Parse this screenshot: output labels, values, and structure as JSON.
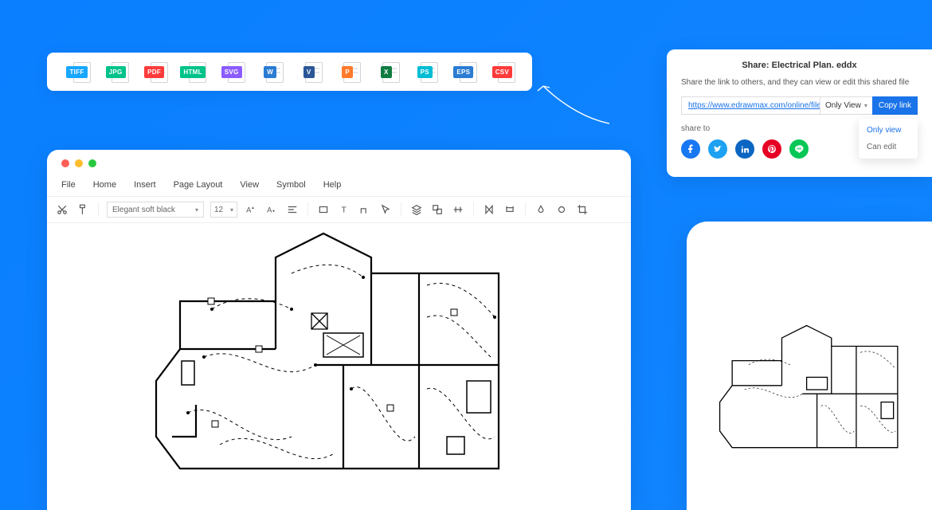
{
  "export_formats": [
    {
      "label": "TIFF",
      "color": "#18a7ff"
    },
    {
      "label": "JPG",
      "color": "#00c389"
    },
    {
      "label": "PDF",
      "color": "#ff3b3b"
    },
    {
      "label": "HTML",
      "color": "#00c389"
    },
    {
      "label": "SVG",
      "color": "#8b5cff"
    },
    {
      "label": "W",
      "color": "#2b7cd3"
    },
    {
      "label": "V",
      "color": "#2b5797"
    },
    {
      "label": "P",
      "color": "#ff7a2b"
    },
    {
      "label": "X",
      "color": "#107c41"
    },
    {
      "label": "PS",
      "color": "#00bcd4"
    },
    {
      "label": "EPS",
      "color": "#2b7cd3"
    },
    {
      "label": "CSV",
      "color": "#ff3b3b"
    }
  ],
  "editor": {
    "menus": [
      "File",
      "Home",
      "Insert",
      "Page Layout",
      "View",
      "Symbol",
      "Help"
    ],
    "font_name": "Elegant soft black",
    "font_size": "12"
  },
  "share": {
    "title": "Share: Electrical Plan. eddx",
    "desc": "Share the link to others, and they can view or edit this shared file",
    "url": "https://www.edrawmax.com/online/files",
    "permission_selected": "Only View",
    "copy_label": "Copy link",
    "share_to_label": "share to",
    "perm_options": [
      "Only view",
      "Can edit"
    ],
    "socials": [
      {
        "name": "facebook",
        "color": "#1877f2",
        "glyph": "f"
      },
      {
        "name": "twitter",
        "color": "#1da1f2",
        "glyph": "t"
      },
      {
        "name": "linkedin",
        "color": "#0a66c2",
        "glyph": "in"
      },
      {
        "name": "pinterest",
        "color": "#e60023",
        "glyph": "p"
      },
      {
        "name": "line",
        "color": "#06c755",
        "glyph": "L"
      }
    ]
  }
}
